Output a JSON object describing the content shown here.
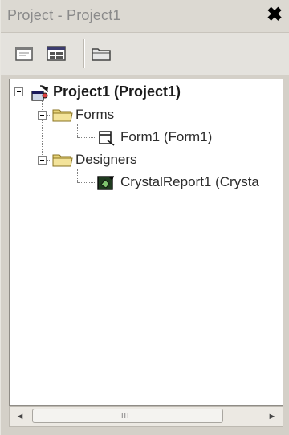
{
  "window": {
    "title": "Project - Project1",
    "close_glyph": "✖"
  },
  "toolbar": {
    "buttons": [
      {
        "name": "view-code-icon"
      },
      {
        "name": "view-object-icon"
      },
      {
        "name": "toggle-folders-icon"
      }
    ]
  },
  "tree": {
    "root": {
      "label": "Project1 (Project1)",
      "icon": "project-icon"
    },
    "forms_folder": {
      "label": "Forms",
      "icon": "folder-icon"
    },
    "form1": {
      "label": "Form1 (Form1)",
      "icon": "form-icon"
    },
    "designers_folder": {
      "label": "Designers",
      "icon": "folder-icon"
    },
    "crystalreport1": {
      "label": "CrystalReport1 (Crysta",
      "icon": "crystal-report-icon"
    }
  },
  "scrollbar": {
    "left_arrow": "◄",
    "right_arrow": "►",
    "grip": "III"
  },
  "colors": {
    "folder": "#e8d47a",
    "folder_dark": "#b89a30"
  }
}
